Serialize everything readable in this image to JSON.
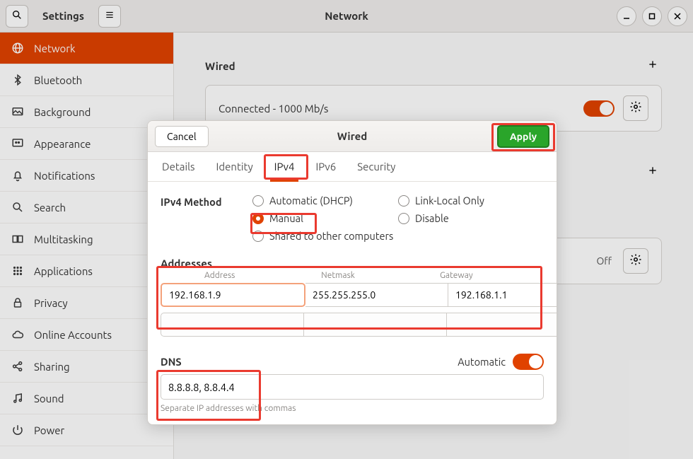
{
  "header": {
    "settings_label": "Settings",
    "page_title": "Network"
  },
  "sidebar": {
    "items": [
      {
        "label": "Network"
      },
      {
        "label": "Bluetooth"
      },
      {
        "label": "Background"
      },
      {
        "label": "Appearance"
      },
      {
        "label": "Notifications"
      },
      {
        "label": "Search"
      },
      {
        "label": "Multitasking"
      },
      {
        "label": "Applications"
      },
      {
        "label": "Privacy"
      },
      {
        "label": "Online Accounts"
      },
      {
        "label": "Sharing"
      },
      {
        "label": "Sound"
      },
      {
        "label": "Power"
      }
    ]
  },
  "main": {
    "wired_section": "Wired",
    "conn_status": "Connected - 1000 Mb/s",
    "vpn_off_label": "Off"
  },
  "dialog": {
    "title": "Wired",
    "cancel": "Cancel",
    "apply": "Apply",
    "tabs": {
      "details": "Details",
      "identity": "Identity",
      "ipv4": "IPv4",
      "ipv6": "IPv6",
      "security": "Security"
    },
    "method_label": "IPv4 Method",
    "methods": {
      "auto": "Automatic (DHCP)",
      "local": "Link-Local Only",
      "manual": "Manual",
      "disable": "Disable",
      "shared": "Shared to other computers"
    },
    "addresses": {
      "title": "Addresses",
      "col_addr": "Address",
      "col_mask": "Netmask",
      "col_gw": "Gateway",
      "row": {
        "address": "192.168.1.9",
        "netmask": "255.255.255.0",
        "gateway": "192.168.1.1"
      }
    },
    "dns": {
      "title": "DNS",
      "auto_label": "Automatic",
      "value": "8.8.8.8, 8.8.4.4",
      "hint": "Separate IP addresses with commas"
    }
  }
}
